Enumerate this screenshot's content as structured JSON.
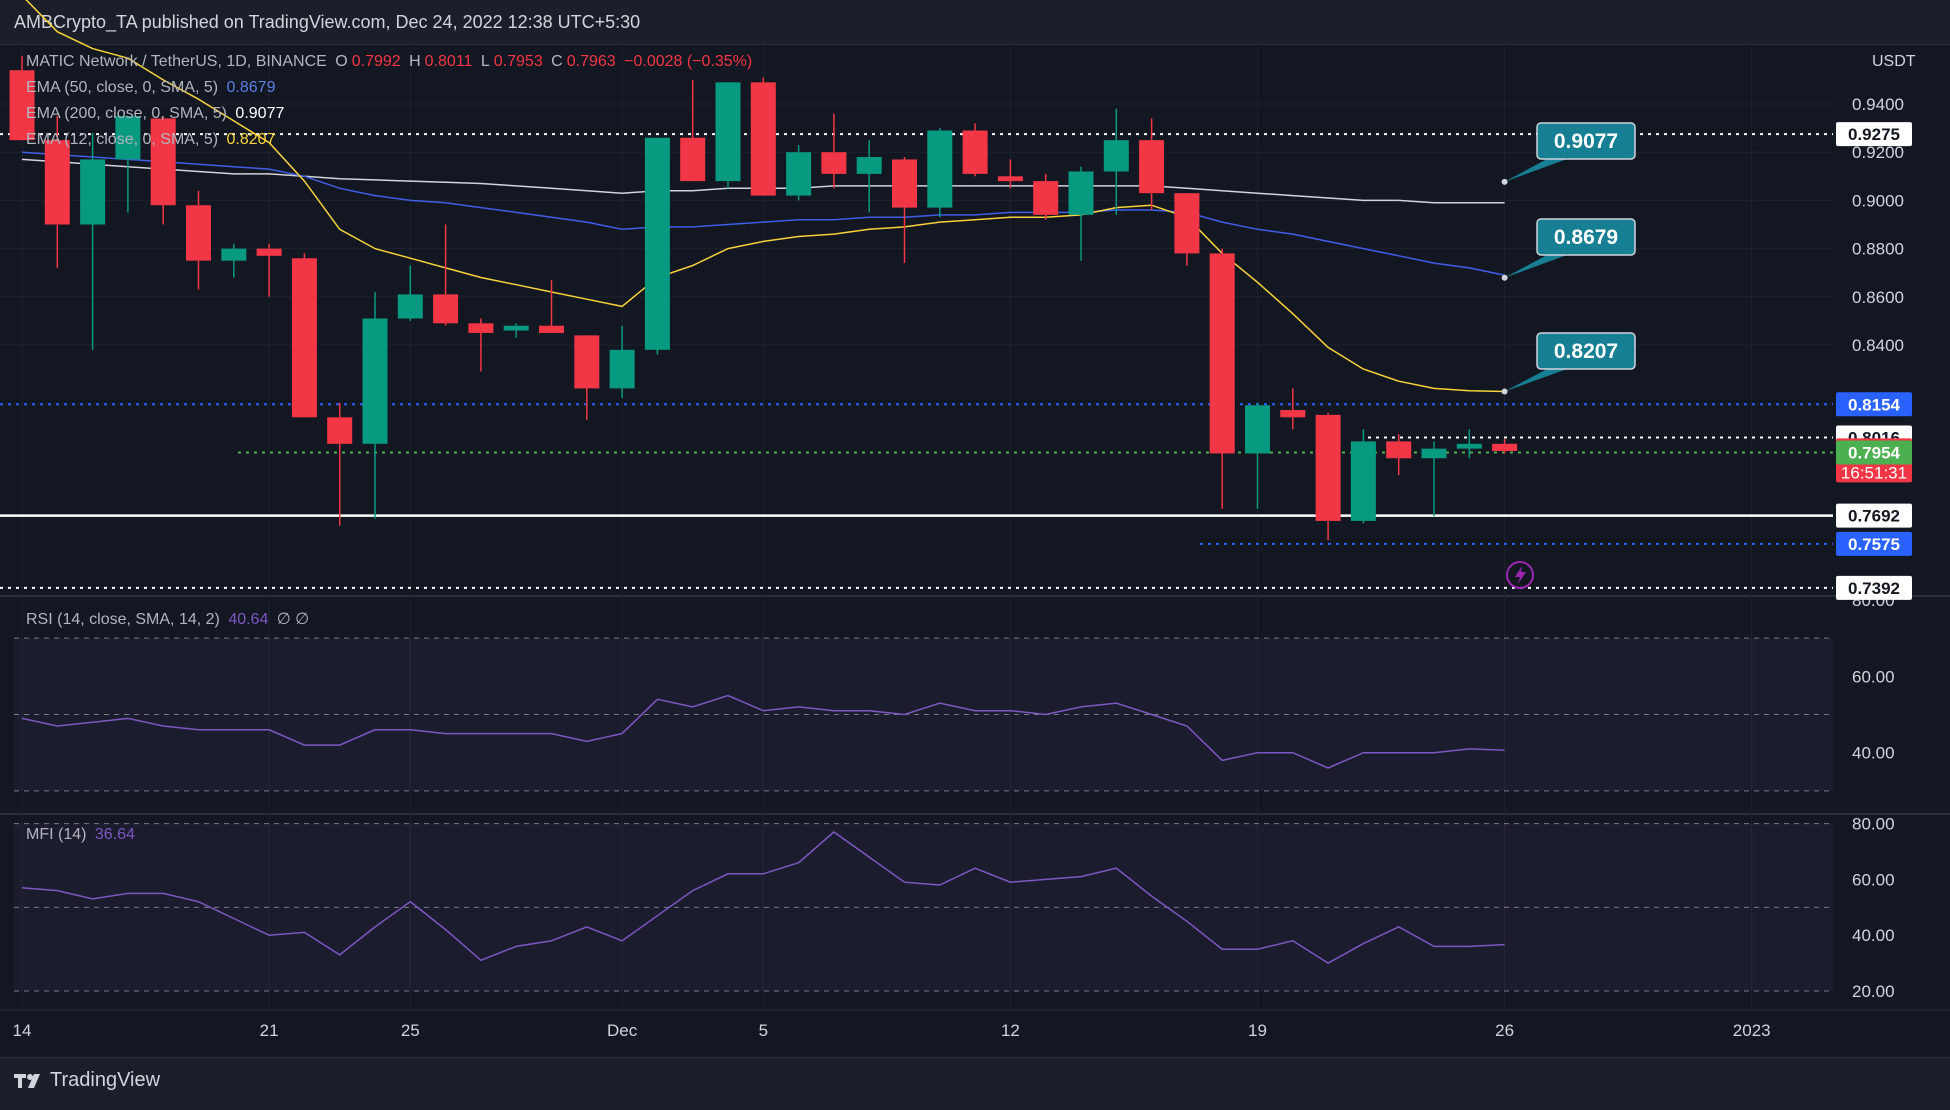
{
  "header": {
    "published_text": "AMBCrypto_TA published on TradingView.com, Dec 24, 2022 12:38 UTC+5:30"
  },
  "footer": {
    "logo_text": "TradingView"
  },
  "legend": {
    "symbol": "MATIC Network / TetherUS, 1D, BINANCE",
    "ohlc": {
      "o_label": "O",
      "o": "0.7992",
      "h_label": "H",
      "h": "0.8011",
      "l_label": "L",
      "l": "0.7953",
      "c_label": "C",
      "c": "0.7963",
      "change": "−0.0028 (−0.35%)"
    },
    "ema50": {
      "label": "EMA (50, close, 0, SMA, 5)",
      "value": "0.8679"
    },
    "ema200": {
      "label": "EMA (200, close, 0, SMA, 5)",
      "value": "0.9077"
    },
    "ema12": {
      "label": "EMA (12, close, 0, SMA, 5)",
      "value": "0.8207"
    },
    "rsi": {
      "label": "RSI (14, close, SMA, 14, 2)",
      "value": "40.64",
      "extra": "∅ ∅"
    },
    "mfi": {
      "label": "MFI (14)",
      "value": "36.64"
    }
  },
  "colors": {
    "up": "#089981",
    "down": "#f23645",
    "ema50": "#3f5ee8",
    "ema200": "#d1d4dc",
    "ema12": "#f7d23b",
    "rsi": "#7e57c2",
    "callout": "#167f93",
    "background": "#131722"
  },
  "chart_data": [
    {
      "type": "candlestick",
      "pair": "MATIC Network / TetherUS",
      "interval": "1D",
      "exchange": "BINANCE",
      "ylabel": "USDT",
      "ylim": [
        0.7392,
        0.95
      ],
      "y_ticks": [
        "0.9400",
        "0.9200",
        "0.9000",
        "0.8800",
        "0.8600",
        "0.8400"
      ],
      "x_ticks": [
        "14",
        "21",
        "25",
        "Dec",
        "5",
        "12",
        "19",
        "26",
        "2023"
      ],
      "x_tick_days": [
        0,
        7,
        11,
        17,
        21,
        28,
        35,
        42,
        49
      ],
      "start_date": "2022-11-12",
      "candles": [
        {
          "o": 0.954,
          "h": 0.96,
          "l": 0.925,
          "c": 0.925
        },
        {
          "o": 0.925,
          "h": 0.935,
          "l": 0.872,
          "c": 0.89
        },
        {
          "o": 0.89,
          "h": 0.928,
          "l": 0.838,
          "c": 0.917
        },
        {
          "o": 0.917,
          "h": 0.935,
          "l": 0.895,
          "c": 0.935
        },
        {
          "o": 0.934,
          "h": 0.935,
          "l": 0.89,
          "c": 0.898
        },
        {
          "o": 0.898,
          "h": 0.904,
          "l": 0.863,
          "c": 0.875
        },
        {
          "o": 0.875,
          "h": 0.882,
          "l": 0.868,
          "c": 0.88
        },
        {
          "o": 0.88,
          "h": 0.882,
          "l": 0.86,
          "c": 0.877
        },
        {
          "o": 0.876,
          "h": 0.878,
          "l": 0.81,
          "c": 0.81
        },
        {
          "o": 0.81,
          "h": 0.816,
          "l": 0.765,
          "c": 0.799
        },
        {
          "o": 0.799,
          "h": 0.862,
          "l": 0.768,
          "c": 0.851
        },
        {
          "o": 0.851,
          "h": 0.873,
          "l": 0.85,
          "c": 0.861
        },
        {
          "o": 0.861,
          "h": 0.89,
          "l": 0.848,
          "c": 0.849
        },
        {
          "o": 0.849,
          "h": 0.851,
          "l": 0.829,
          "c": 0.845
        },
        {
          "o": 0.846,
          "h": 0.849,
          "l": 0.843,
          "c": 0.848
        },
        {
          "o": 0.848,
          "h": 0.867,
          "l": 0.845,
          "c": 0.845
        },
        {
          "o": 0.844,
          "h": 0.844,
          "l": 0.809,
          "c": 0.822
        },
        {
          "o": 0.822,
          "h": 0.848,
          "l": 0.818,
          "c": 0.838
        },
        {
          "o": 0.838,
          "h": 0.925,
          "l": 0.836,
          "c": 0.926
        },
        {
          "o": 0.926,
          "h": 0.95,
          "l": 0.908,
          "c": 0.908
        },
        {
          "o": 0.908,
          "h": 0.945,
          "l": 0.905,
          "c": 0.949
        },
        {
          "o": 0.949,
          "h": 0.951,
          "l": 0.902,
          "c": 0.902
        },
        {
          "o": 0.902,
          "h": 0.923,
          "l": 0.9,
          "c": 0.92
        },
        {
          "o": 0.92,
          "h": 0.936,
          "l": 0.905,
          "c": 0.911
        },
        {
          "o": 0.911,
          "h": 0.925,
          "l": 0.895,
          "c": 0.918
        },
        {
          "o": 0.917,
          "h": 0.918,
          "l": 0.874,
          "c": 0.897
        },
        {
          "o": 0.897,
          "h": 0.93,
          "l": 0.893,
          "c": 0.929
        },
        {
          "o": 0.929,
          "h": 0.932,
          "l": 0.91,
          "c": 0.911
        },
        {
          "o": 0.91,
          "h": 0.917,
          "l": 0.905,
          "c": 0.908
        },
        {
          "o": 0.908,
          "h": 0.911,
          "l": 0.892,
          "c": 0.894
        },
        {
          "o": 0.894,
          "h": 0.914,
          "l": 0.875,
          "c": 0.912
        },
        {
          "o": 0.912,
          "h": 0.938,
          "l": 0.894,
          "c": 0.925
        },
        {
          "o": 0.925,
          "h": 0.934,
          "l": 0.896,
          "c": 0.903
        },
        {
          "o": 0.903,
          "h": 0.903,
          "l": 0.873,
          "c": 0.878
        },
        {
          "o": 0.878,
          "h": 0.88,
          "l": 0.772,
          "c": 0.795
        },
        {
          "o": 0.795,
          "h": 0.816,
          "l": 0.772,
          "c": 0.815
        },
        {
          "o": 0.813,
          "h": 0.822,
          "l": 0.805,
          "c": 0.81
        },
        {
          "o": 0.811,
          "h": 0.812,
          "l": 0.759,
          "c": 0.767
        },
        {
          "o": 0.767,
          "h": 0.805,
          "l": 0.766,
          "c": 0.8
        },
        {
          "o": 0.8,
          "h": 0.803,
          "l": 0.786,
          "c": 0.793
        },
        {
          "o": 0.793,
          "h": 0.8,
          "l": 0.769,
          "c": 0.797
        },
        {
          "o": 0.797,
          "h": 0.805,
          "l": 0.793,
          "c": 0.799
        },
        {
          "o": 0.799,
          "h": 0.801,
          "l": 0.795,
          "c": 0.796
        }
      ],
      "ema200": [
        0.917,
        0.916,
        0.915,
        0.914,
        0.913,
        0.912,
        0.911,
        0.911,
        0.91,
        0.909,
        0.9085,
        0.908,
        0.9075,
        0.907,
        0.906,
        0.905,
        0.904,
        0.903,
        0.904,
        0.904,
        0.905,
        0.905,
        0.905,
        0.906,
        0.906,
        0.906,
        0.906,
        0.906,
        0.906,
        0.906,
        0.906,
        0.906,
        0.906,
        0.905,
        0.904,
        0.903,
        0.902,
        0.901,
        0.9,
        0.9,
        0.899,
        0.899,
        0.899
      ],
      "ema50": [
        0.92,
        0.919,
        0.918,
        0.917,
        0.916,
        0.915,
        0.914,
        0.913,
        0.91,
        0.905,
        0.902,
        0.9,
        0.899,
        0.897,
        0.895,
        0.893,
        0.891,
        0.888,
        0.889,
        0.889,
        0.89,
        0.891,
        0.892,
        0.892,
        0.893,
        0.893,
        0.894,
        0.894,
        0.895,
        0.895,
        0.895,
        0.896,
        0.896,
        0.895,
        0.891,
        0.888,
        0.886,
        0.883,
        0.88,
        0.877,
        0.874,
        0.872,
        0.869
      ],
      "ema12": [
        0.985,
        0.97,
        0.963,
        0.959,
        0.95,
        0.942,
        0.933,
        0.924,
        0.908,
        0.888,
        0.88,
        0.876,
        0.872,
        0.868,
        0.865,
        0.862,
        0.859,
        0.856,
        0.868,
        0.873,
        0.88,
        0.883,
        0.885,
        0.886,
        0.888,
        0.889,
        0.891,
        0.892,
        0.893,
        0.893,
        0.894,
        0.897,
        0.898,
        0.893,
        0.878,
        0.866,
        0.853,
        0.839,
        0.83,
        0.825,
        0.822,
        0.821,
        0.8207
      ],
      "horizontal_lines": [
        {
          "price": 0.9275,
          "style": "dotted",
          "color": "#ffffff"
        },
        {
          "price": 0.8154,
          "style": "dotted",
          "color": "#2962ff"
        },
        {
          "price": 0.8016,
          "style": "dotted",
          "color": "#ffffff"
        },
        {
          "price": 0.7954,
          "style": "dotted",
          "color": "#4caf50"
        },
        {
          "price": 0.7692,
          "style": "solid",
          "color": "#ffffff"
        },
        {
          "price": 0.7575,
          "style": "dotted",
          "color": "#2962ff"
        },
        {
          "price": 0.7392,
          "style": "dotted",
          "color": "#ffffff"
        }
      ],
      "price_tags": [
        {
          "text": "0.9275",
          "price": 0.9275,
          "bg": "#ffffff",
          "fg": "#131722"
        },
        {
          "text": "0.8154",
          "price": 0.8154,
          "bg": "#2962ff",
          "fg": "#ffffff"
        },
        {
          "text": "0.8016",
          "price": 0.8016,
          "bg": "#ffffff",
          "fg": "#131722"
        },
        {
          "text": "0.7963",
          "price": 0.7963,
          "bg": "#f23645",
          "fg": "#ffffff",
          "countdown": "16:51:31"
        },
        {
          "text": "0.7954",
          "price": 0.7954,
          "bg": "#4caf50",
          "fg": "#ffffff"
        },
        {
          "text": "0.7692",
          "price": 0.7692,
          "bg": "#ffffff",
          "fg": "#131722"
        },
        {
          "text": "0.7575",
          "price": 0.7575,
          "bg": "#2962ff",
          "fg": "#ffffff"
        },
        {
          "text": "0.7392",
          "price": 0.7392,
          "bg": "#ffffff",
          "fg": "#131722"
        }
      ],
      "callouts": [
        {
          "text": "0.9077",
          "price": 0.9077
        },
        {
          "text": "0.8679",
          "price": 0.8679
        },
        {
          "text": "0.8207",
          "price": 0.8207
        }
      ]
    },
    {
      "type": "line",
      "name": "RSI (14, close, SMA, 14, 2)",
      "ylim": [
        25,
        80
      ],
      "y_ticks": [
        "80.00",
        "60.00",
        "40.00"
      ],
      "bands": [
        70,
        50,
        30
      ],
      "values": [
        49,
        47,
        48,
        49,
        47,
        46,
        46,
        46,
        42,
        42,
        46,
        46,
        45,
        45,
        45,
        45,
        43,
        45,
        54,
        52,
        55,
        51,
        52,
        51,
        51,
        50,
        53,
        51,
        51,
        50,
        52,
        53,
        50,
        47,
        38,
        40,
        40,
        36,
        40,
        40,
        40,
        41,
        40.64
      ]
    },
    {
      "type": "line",
      "name": "MFI (14)",
      "ylim": [
        15,
        82
      ],
      "y_ticks": [
        "80.00",
        "60.00",
        "40.00",
        "20.00"
      ],
      "bands": [
        80,
        50,
        20
      ],
      "values": [
        57,
        56,
        53,
        55,
        55,
        52,
        46,
        40,
        41,
        33,
        43,
        52,
        42,
        31,
        36,
        38,
        43,
        38,
        47,
        56,
        62,
        62,
        66,
        77,
        68,
        59,
        58,
        64,
        59,
        60,
        61,
        64,
        54,
        45,
        35,
        35,
        38,
        30,
        37,
        43,
        36,
        36,
        36.64
      ]
    }
  ]
}
